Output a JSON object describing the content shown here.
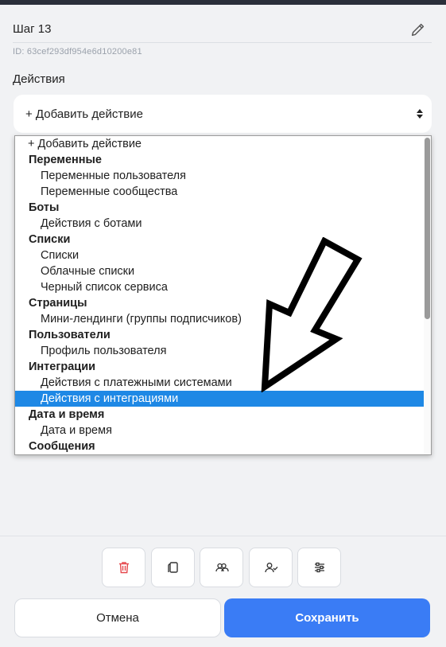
{
  "step": {
    "title": "Шаг 13",
    "id_text": "ID: 63cef293df954e6d10200e81"
  },
  "actions": {
    "label": "Действия",
    "selected_value": "+ Добавить действие"
  },
  "dropdown": {
    "rows": [
      {
        "text": "+ Добавить действие",
        "kind": "top"
      },
      {
        "text": "Переменные",
        "kind": "head"
      },
      {
        "text": "Переменные пользователя",
        "kind": "opt"
      },
      {
        "text": "Переменные сообщества",
        "kind": "opt"
      },
      {
        "text": "Боты",
        "kind": "head"
      },
      {
        "text": "Действия с ботами",
        "kind": "opt"
      },
      {
        "text": "Списки",
        "kind": "head"
      },
      {
        "text": "Списки",
        "kind": "opt"
      },
      {
        "text": "Облачные списки",
        "kind": "opt"
      },
      {
        "text": "Черный список сервиса",
        "kind": "opt"
      },
      {
        "text": "Страницы",
        "kind": "head"
      },
      {
        "text": "Мини-лендинги (группы подписчиков)",
        "kind": "opt"
      },
      {
        "text": "Пользователи",
        "kind": "head"
      },
      {
        "text": "Профиль пользователя",
        "kind": "opt"
      },
      {
        "text": "Интеграции",
        "kind": "head"
      },
      {
        "text": "Действия с платежными системами",
        "kind": "opt"
      },
      {
        "text": "Действия с интеграциями",
        "kind": "opt",
        "selected": true
      },
      {
        "text": "Дата и время",
        "kind": "head"
      },
      {
        "text": "Дата и время",
        "kind": "opt"
      },
      {
        "text": "Сообщения",
        "kind": "head"
      }
    ],
    "highlight_color": "#1e88e5"
  },
  "toolbar": {
    "icons": [
      "trash-icon",
      "copy-icon",
      "users-icon",
      "user-check-icon",
      "sliders-icon"
    ]
  },
  "buttons": {
    "cancel_label": "Отмена",
    "save_label": "Сохранить"
  },
  "colors": {
    "accent": "#3a7cf5",
    "delete": "#e5484d"
  }
}
